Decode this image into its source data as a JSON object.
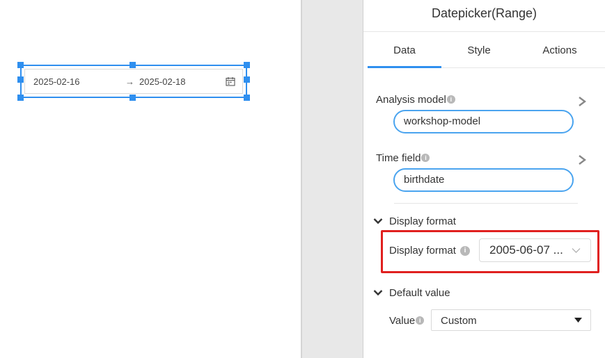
{
  "canvas": {
    "date_start": "2025-02-16",
    "arrow": "→",
    "date_end": "2025-02-18"
  },
  "panel": {
    "title": "Datepicker(Range)",
    "tabs": [
      "Data",
      "Style",
      "Actions"
    ],
    "analysis_model": {
      "label": "Analysis model",
      "value": "workshop-model"
    },
    "time_field": {
      "label": "Time field",
      "value": "birthdate"
    },
    "display_format_section": {
      "header": "Display format",
      "field_label": "Display format",
      "value": "2005-06-07 ..."
    },
    "default_value_section": {
      "header": "Default value",
      "field_label": "Value",
      "value": "Custom"
    }
  },
  "colors": {
    "accent": "#2f8fef",
    "highlight": "#e0201f"
  }
}
